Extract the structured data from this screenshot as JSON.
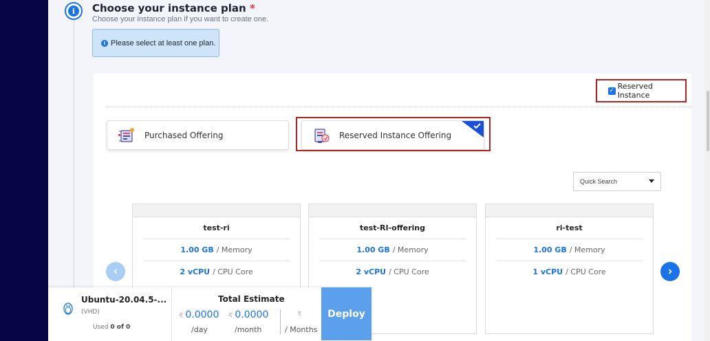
{
  "step": {
    "title": "Choose your instance plan",
    "required_mark": "*",
    "subtitle": "Choose your instance plan if you want to create one.",
    "notice": "Please select at least one plan."
  },
  "filter": {
    "reserved_instance_label": "Reserved Instance",
    "reserved_instance_checked": true
  },
  "offerings": [
    {
      "label": "Purchased Offering",
      "selected": false
    },
    {
      "label": "Reserved Instance Offering",
      "selected": true
    }
  ],
  "search": {
    "placeholder": "Quick Search"
  },
  "plans": [
    {
      "name": "test-ri",
      "memory_value": "1.00 GB",
      "memory_unit": "/ Memory",
      "cpu_value": "2 vCPU",
      "cpu_unit": "/ CPU Core"
    },
    {
      "name": "test-RI-offering",
      "memory_value": "1.00 GB",
      "memory_unit": "/ Memory",
      "cpu_value": "2 vCPU",
      "cpu_unit": "/ CPU Core"
    },
    {
      "name": "ri-test",
      "memory_value": "1.00 GB",
      "memory_unit": "/ Memory",
      "cpu_value": "1 vCPU",
      "cpu_unit": "/ CPU Core"
    }
  ],
  "footer": {
    "os_name": "Ubuntu-20.04.5-...",
    "os_type": "(VHD)",
    "used_prefix": "Used",
    "used_value": "0 of 0",
    "estimate_title": "Total Estimate",
    "currency": "₹",
    "per_day_value": "0.0000",
    "per_day_unit": "/day",
    "per_month_value": "0.0000",
    "per_month_unit": "/month",
    "months_unit": "/ Months",
    "deploy_label": "Deploy"
  },
  "colors": {
    "sidebar": "#060646",
    "accent": "#1a73e8",
    "highlight_border": "#b22222",
    "deploy": "#5aa0ec"
  },
  "icons": {
    "step": "info-icon",
    "prev": "chevron-left-icon",
    "next": "chevron-right-icon",
    "os": "linux-penguin-icon"
  }
}
